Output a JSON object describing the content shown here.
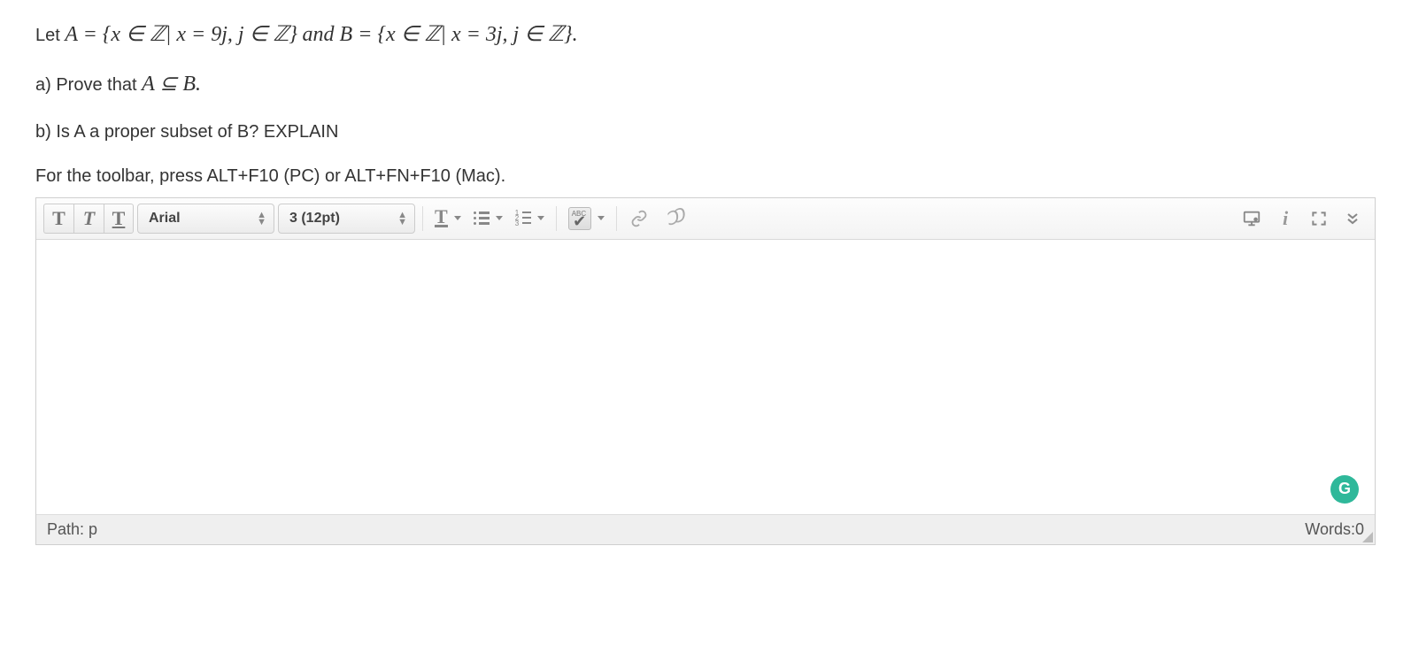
{
  "question": {
    "intro": "Let  ",
    "set_A_lead": "A = {x  ∈ ℤ|  x = 9j, j ∈ ℤ}",
    "conj": " and ",
    "set_B_lead": "B = {x  ∈ ℤ|  x = 3j, j ∈ ℤ}.",
    "part_a_prefix": "a) Prove that ",
    "part_a_math": "A ⊆ B.",
    "part_b": "b) Is A a proper subset of B? EXPLAIN",
    "hint": "For the toolbar, press ALT+F10 (PC) or ALT+FN+F10 (Mac)."
  },
  "toolbar": {
    "font_family": "Arial",
    "font_size": "3 (12pt)"
  },
  "statusbar": {
    "path_label": "Path: ",
    "path_value": "p",
    "words_label": "Words:",
    "words_count": "0"
  },
  "grammarly_badge": "G"
}
